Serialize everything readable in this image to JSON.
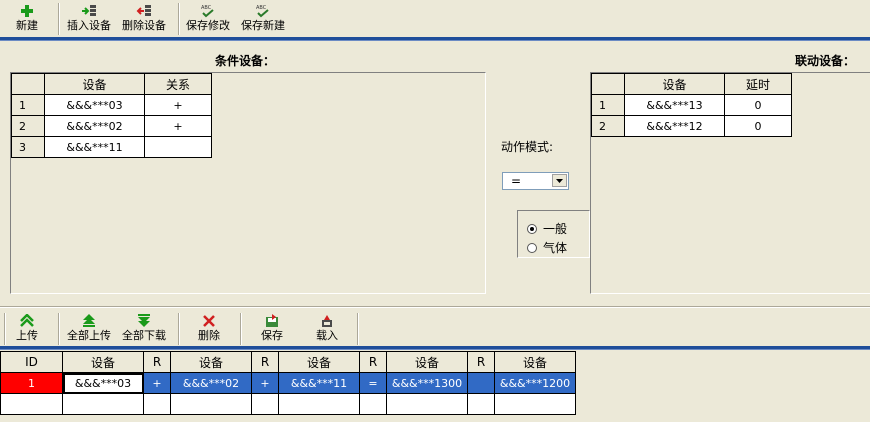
{
  "top_toolbar": {
    "new": "新建",
    "insert": "插入设备",
    "delete": "删除设备",
    "save_edit": "保存修改",
    "save_new": "保存新建"
  },
  "condition_panel": {
    "title": "条件设备：",
    "headers": [
      "设备",
      "关系"
    ],
    "rows": [
      {
        "num": "1",
        "device": "&&&***03",
        "rel": "+"
      },
      {
        "num": "2",
        "device": "&&&***02",
        "rel": "+"
      },
      {
        "num": "3",
        "device": "&&&***11",
        "rel": ""
      }
    ]
  },
  "action": {
    "mode_label": "动作模式:",
    "mode_value": "=",
    "radio_general": "一般",
    "radio_gas": "气体"
  },
  "linked_panel": {
    "title": "联动设备：",
    "headers": [
      "设备",
      "延时"
    ],
    "rows": [
      {
        "num": "1",
        "device": "&&&***13",
        "delay": "0"
      },
      {
        "num": "2",
        "device": "&&&***12",
        "delay": "0"
      }
    ]
  },
  "bottom_toolbar": {
    "upload": "上传",
    "upload_all": "全部上传",
    "download_all": "全部下载",
    "delete": "删除",
    "save": "保存",
    "load": "载入"
  },
  "bottom_grid": {
    "headers": [
      "ID",
      "设备",
      "R",
      "设备",
      "R",
      "设备",
      "R",
      "设备",
      "R",
      "设备"
    ],
    "row1": [
      "1",
      "&&&***03",
      "+",
      "&&&***02",
      "+",
      "&&&***11",
      "=",
      "&&&***1300",
      "",
      "&&&***1200"
    ]
  },
  "colors": {
    "accent_bar": "#1f4e9a",
    "selection": "#316ac5",
    "id_highlight": "#ff0000"
  }
}
